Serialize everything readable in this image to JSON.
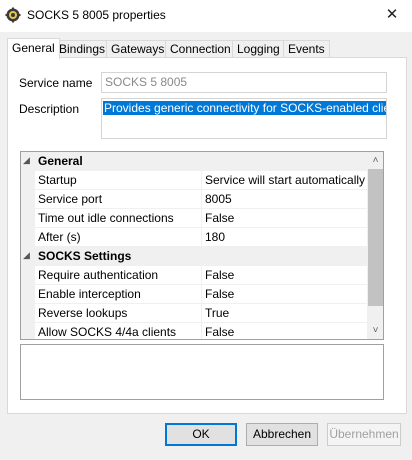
{
  "window": {
    "title": "SOCKS 5 8005 properties",
    "close_glyph": "✕",
    "icon": "service-icon"
  },
  "tabs": [
    {
      "label": "General",
      "active": true
    },
    {
      "label": "Bindings",
      "active": false
    },
    {
      "label": "Gateways",
      "active": false
    },
    {
      "label": "Connection",
      "active": false
    },
    {
      "label": "Logging",
      "active": false
    },
    {
      "label": "Events",
      "active": false
    }
  ],
  "form": {
    "service_name_label": "Service name",
    "service_name_value": "SOCKS 5 8005",
    "description_label": "Description",
    "description_value": "Provides generic connectivity for SOCKS-enabled client soft"
  },
  "grid": {
    "categories": [
      {
        "title": "General",
        "rows": [
          {
            "name": "Startup",
            "value": "Service will start automatically"
          },
          {
            "name": "Service port",
            "value": "8005"
          },
          {
            "name": "Time out idle connections",
            "value": "False"
          },
          {
            "name": "After (s)",
            "value": "180"
          }
        ]
      },
      {
        "title": "SOCKS Settings",
        "rows": [
          {
            "name": "Require authentication",
            "value": "False"
          },
          {
            "name": "Enable interception",
            "value": "False"
          },
          {
            "name": "Reverse lookups",
            "value": "True"
          },
          {
            "name": "Allow SOCKS 4/4a clients",
            "value": "False"
          }
        ]
      }
    ],
    "collapse_glyph": "◢",
    "scroll_up_glyph": "˄",
    "scroll_down_glyph": "˅"
  },
  "buttons": {
    "ok": "OK",
    "cancel": "Abbrechen",
    "apply": "Übernehmen"
  },
  "colors": {
    "selection": "#0078d7",
    "window_bg": "#f0f0f0",
    "panel_bg": "#ffffff"
  }
}
